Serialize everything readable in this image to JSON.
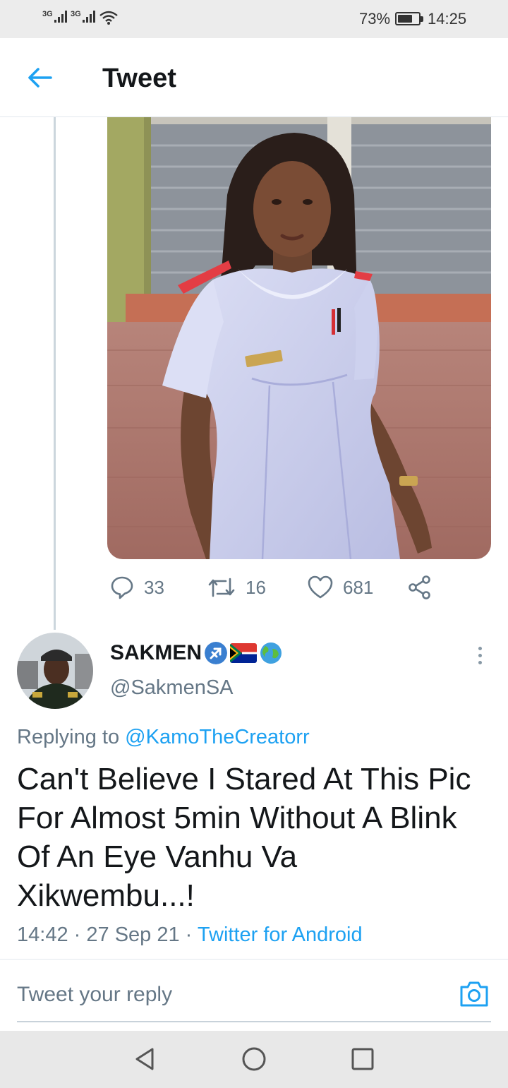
{
  "status_bar": {
    "signal_1": "3G",
    "signal_2": "3G",
    "battery_percent": "73%",
    "battery_level": 0.73,
    "time": "14:25"
  },
  "header": {
    "title": "Tweet",
    "back_icon": "arrow-left-icon"
  },
  "thread_tweet": {
    "actions": {
      "replies": "33",
      "retweets": "16",
      "likes": "681"
    }
  },
  "reply_tweet": {
    "display_name": "SAKMEN",
    "name_emojis": [
      "sagittarius-icon",
      "south-africa-flag-icon",
      "globe-icon"
    ],
    "handle": "@SakmenSA",
    "replying_prefix": "Replying to",
    "replying_to": "@KamoTheCreatorr",
    "text": "Can't Believe I Stared At This Pic For Almost 5min Without A Blink Of An Eye Vanhu Va Xikwembu...!",
    "time": "14:42",
    "date": "27 Sep 21",
    "source": "Twitter for Android",
    "separator": "·"
  },
  "reply_box": {
    "placeholder": "Tweet your reply"
  },
  "colors": {
    "accent": "#1da1f2",
    "secondary_text": "#657786",
    "primary_text": "#14171a"
  }
}
